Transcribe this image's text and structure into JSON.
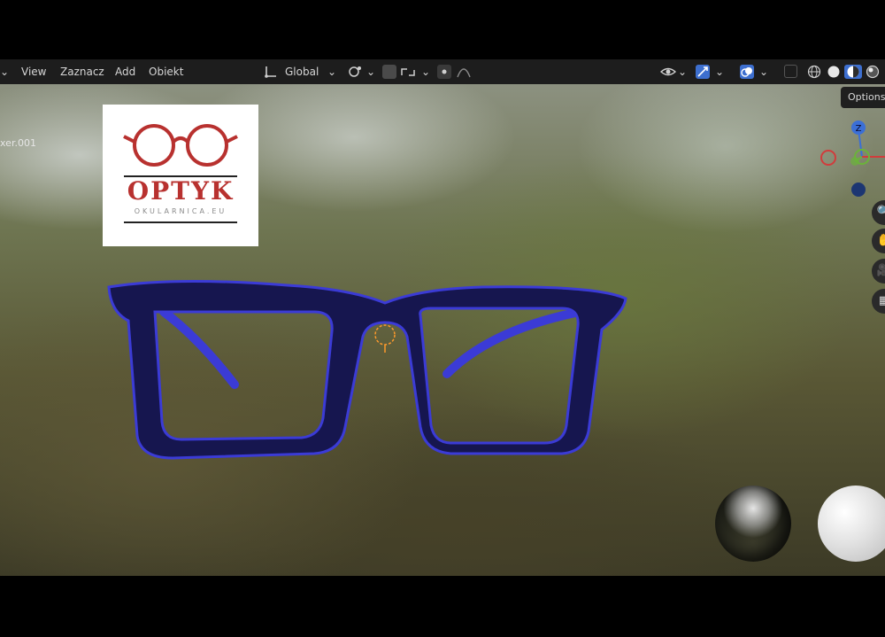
{
  "header": {
    "menu_stub": "⌄",
    "menu": [
      "View",
      "Zaznacz",
      "Add",
      "Obiekt"
    ],
    "transform_orientation": "Global",
    "dropdown_glyph": "⌄"
  },
  "viewport": {
    "object_label": "xer.001",
    "tooltip": "Options",
    "gizmo_z_label": "Z",
    "nav_glyphs": [
      "🔍",
      "✋",
      "🎥",
      "▦"
    ]
  },
  "logo": {
    "brand": "OPTYK",
    "site": "OKULARNICA.EU"
  },
  "icons": {
    "transform": "transform-orientation-icon",
    "pivot": "pivot-point-icon",
    "snap": "snap-icon",
    "proportional": "proportional-editing-icon",
    "visibility": "visibility-icon",
    "gizmo": "gizmo-toggle-icon",
    "overlay": "overlay-icon",
    "xray": "xray-icon",
    "shading_wire": "wireframe-shading-icon",
    "shading_solid": "solid-shading-icon",
    "shading_material": "material-shading-icon",
    "shading_render": "rendered-shading-icon"
  },
  "colors": {
    "frame_blue": "#1a1a6e",
    "frame_highlight": "#3b3bd6",
    "brand_red": "#b8312f",
    "gizmo_x": "#d13c3c",
    "gizmo_y": "#6bb33a",
    "gizmo_z": "#3b6fd6",
    "header_bg": "#1d1d1d"
  }
}
